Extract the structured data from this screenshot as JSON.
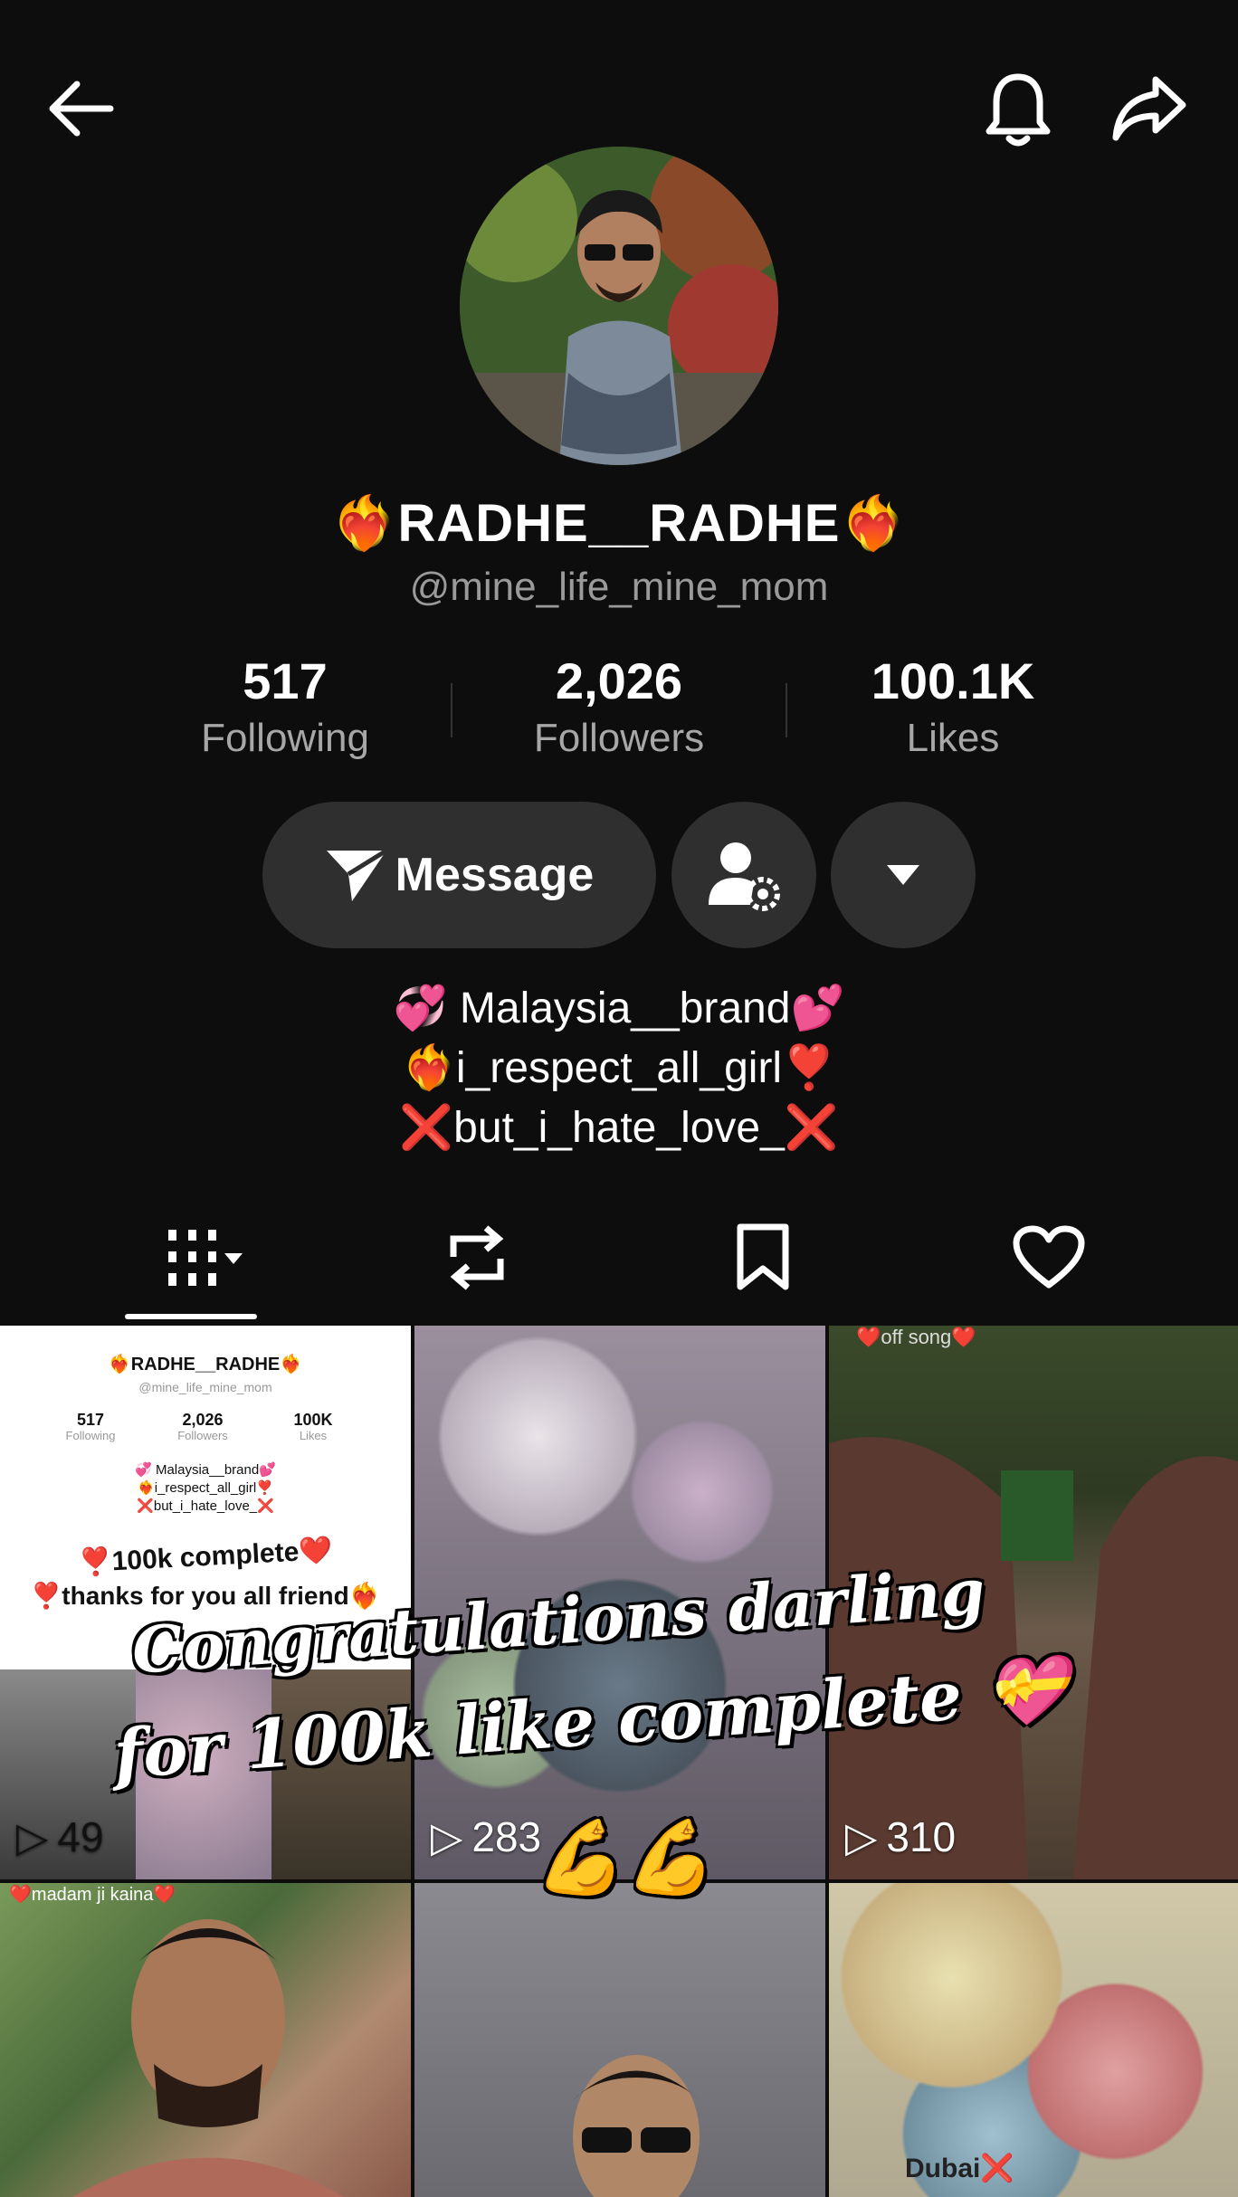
{
  "profile": {
    "display_name": "RADHE__RADHE",
    "name_emoji": "❤️‍🔥",
    "handle": "@mine_life_mine_mom"
  },
  "stats": [
    {
      "value": "517",
      "label": "Following"
    },
    {
      "value": "2,026",
      "label": "Followers"
    },
    {
      "value": "100.1K",
      "label": "Likes"
    }
  ],
  "actions": {
    "message_label": "Message"
  },
  "bio": [
    {
      "prefix": "💞",
      "text": " Malaysia__brand",
      "suffix": "💕"
    },
    {
      "prefix": "❤️‍🔥",
      "text": "i_respect_all_girl",
      "suffix": "❣️"
    },
    {
      "prefix": "❌",
      "text": "but_i_hate_love_",
      "suffix": "❌"
    }
  ],
  "videos": [
    {
      "views": "49"
    },
    {
      "views": "283"
    },
    {
      "views": "310"
    },
    {
      "views": ""
    },
    {
      "views": ""
    },
    {
      "views": ""
    }
  ],
  "thumb_texts": {
    "t1_title": "❤️‍🔥RADHE__RADHE❤️‍🔥",
    "t1_handle": "@mine_life_mine_mom",
    "t1_stat1": "517",
    "t1_stat1_lbl": "Following",
    "t1_stat2": "2,026",
    "t1_stat2_lbl": "Followers",
    "t1_stat3": "100K",
    "t1_stat3_lbl": "Likes",
    "t1_bio1": "💞 Malaysia__brand💕",
    "t1_bio2": "❤️‍🔥i_respect_all_girl❣️",
    "t1_bio3": "❌but_i_hate_love_❌",
    "t1_line1": "❣️100k complete❤️",
    "t1_line2": "❣️thanks for you all friend❤️‍🔥",
    "t3_caption": "❤️off song❤️",
    "t4_caption": "❤️madam ji kaina❤️",
    "t6_caption": "Dubai❌"
  },
  "overlay": {
    "line1": "Congratulations darling",
    "line2": "for 100k like complete 💝",
    "line3": "💪💪"
  }
}
